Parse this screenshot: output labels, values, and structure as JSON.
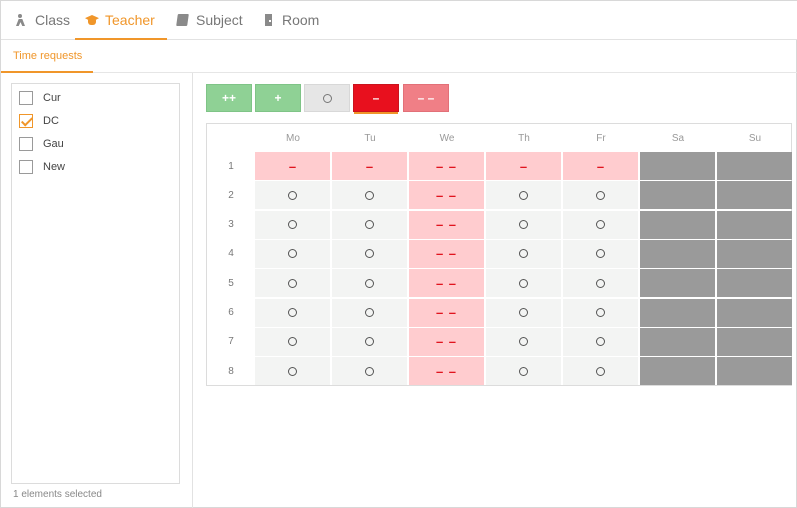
{
  "tabs": [
    {
      "label": "Class",
      "icon": "class-icon"
    },
    {
      "label": "Teacher",
      "icon": "teacher-icon",
      "active": true
    },
    {
      "label": "Subject",
      "icon": "subject-icon"
    },
    {
      "label": "Room",
      "icon": "room-icon"
    }
  ],
  "subtab": {
    "label": "Time requests"
  },
  "list": {
    "items": [
      {
        "label": "Cur",
        "checked": false
      },
      {
        "label": "DC",
        "checked": true
      },
      {
        "label": "Gau",
        "checked": false
      },
      {
        "label": "New",
        "checked": false
      }
    ],
    "status": "1 elements selected"
  },
  "toolbar": {
    "buttons": [
      {
        "label": "++",
        "kind": "pp"
      },
      {
        "label": "+",
        "kind": "p"
      },
      {
        "label": "",
        "kind": "o",
        "icon": "circle-icon"
      },
      {
        "label": "–",
        "kind": "m",
        "selected": true
      },
      {
        "label": "– –",
        "kind": "mm"
      }
    ]
  },
  "grid": {
    "days": [
      "Mo",
      "Tu",
      "We",
      "Th",
      "Fr",
      "Sa",
      "Su"
    ],
    "periods": [
      "1",
      "2",
      "3",
      "4",
      "5",
      "6",
      "7",
      "8"
    ],
    "symbols": {
      "m": "–",
      "mm": "– –"
    },
    "rows": [
      [
        "m",
        "m",
        "mm",
        "m",
        "m",
        "off",
        "off"
      ],
      [
        "o",
        "o",
        "mm",
        "o",
        "o",
        "off",
        "off"
      ],
      [
        "o",
        "o",
        "mm",
        "o",
        "o",
        "off",
        "off"
      ],
      [
        "o",
        "o",
        "mm",
        "o",
        "o",
        "off",
        "off"
      ],
      [
        "o",
        "o",
        "mm",
        "o",
        "o",
        "off",
        "off"
      ],
      [
        "o",
        "o",
        "mm",
        "o",
        "o",
        "off",
        "off"
      ],
      [
        "o",
        "o",
        "mm",
        "o",
        "o",
        "off",
        "off"
      ],
      [
        "o",
        "o",
        "mm",
        "o",
        "o",
        "off",
        "off"
      ]
    ]
  },
  "colors": {
    "accent": "#f0962a",
    "plus": "#8fd195",
    "minus": "#e8101e",
    "minus_light": "#ffcccf",
    "unavailable": "#9a9a9a"
  }
}
